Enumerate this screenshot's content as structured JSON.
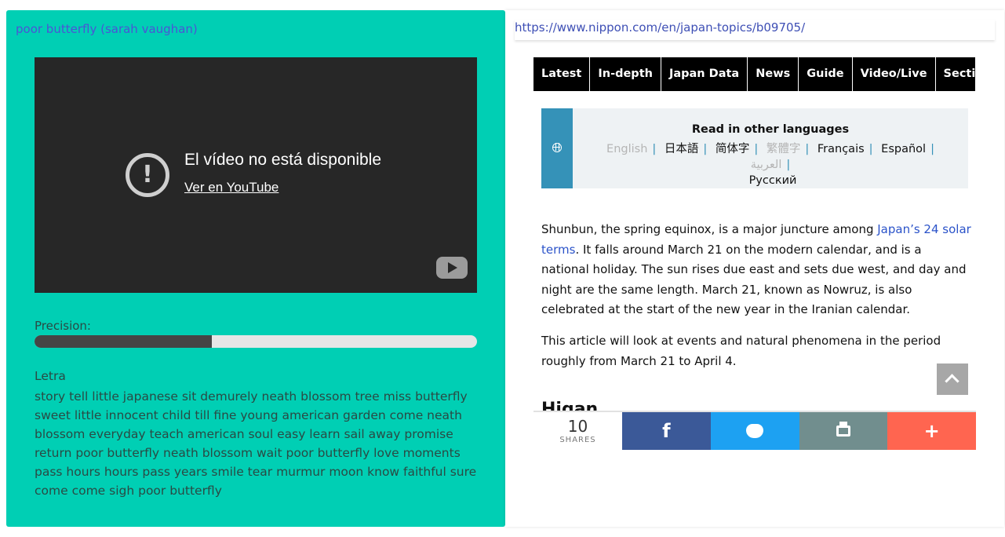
{
  "left": {
    "song_title": "poor butterfly (sarah vaughan)",
    "video": {
      "message": "El vídeo no está disponible",
      "link": "Ver en YouTube"
    },
    "precision_label": "Precision:",
    "precision_value": 0.4,
    "lyrics_label": "Letra",
    "lyrics_text": "story tell little japanese sit demurely neath blossom tree miss butterfly sweet little innocent child till fine young american garden come neath blossom everyday teach american soul easy learn sail away promise return poor butterfly neath blossom wait poor butterfly love moments pass hours hours pass years smile tear murmur moon know faithful sure come come sigh poor butterfly",
    "colors": {
      "panel": "#00cfb4",
      "title": "#4a55d6"
    }
  },
  "right": {
    "url": "https://www.nippon.com/en/japan-topics/b09705/",
    "nav": [
      "Latest",
      "In-depth",
      "Japan Data",
      "News",
      "Guide",
      "Video/Live",
      "Sections"
    ],
    "languages": {
      "title": "Read in other languages",
      "items": [
        {
          "label": "English",
          "state": "muted"
        },
        {
          "label": "日本語",
          "state": "active"
        },
        {
          "label": "简体字",
          "state": "active"
        },
        {
          "label": "繁體字",
          "state": "muted"
        },
        {
          "label": "Français",
          "state": "active"
        },
        {
          "label": "Español",
          "state": "active"
        },
        {
          "label": "العربية",
          "state": "muted"
        },
        {
          "label": "Русский",
          "state": "active"
        }
      ]
    },
    "article": {
      "p1_before": "Shunbun, the spring equinox, is a major juncture among ",
      "p1_link": "Japan’s 24 solar terms",
      "p1_after": ". It falls around March 21 on the modern calendar, and is a national holiday. The sun rises due east and sets due west, and day and night are the same length. March 21, known as Nowruz, is also celebrated at the start of the new year in the Iranian calendar.",
      "p2": "This article will look at events and natural phenomena in the period roughly from March 21 to April 4.",
      "heading": "Higan"
    },
    "share": {
      "count": "10",
      "count_label": "SHARES",
      "facebook_icon": "f",
      "more_icon": "+",
      "colors": {
        "facebook": "#3b5998",
        "twitter": "#1da1f2",
        "print": "#718e8e",
        "more": "#ff6550"
      }
    }
  }
}
